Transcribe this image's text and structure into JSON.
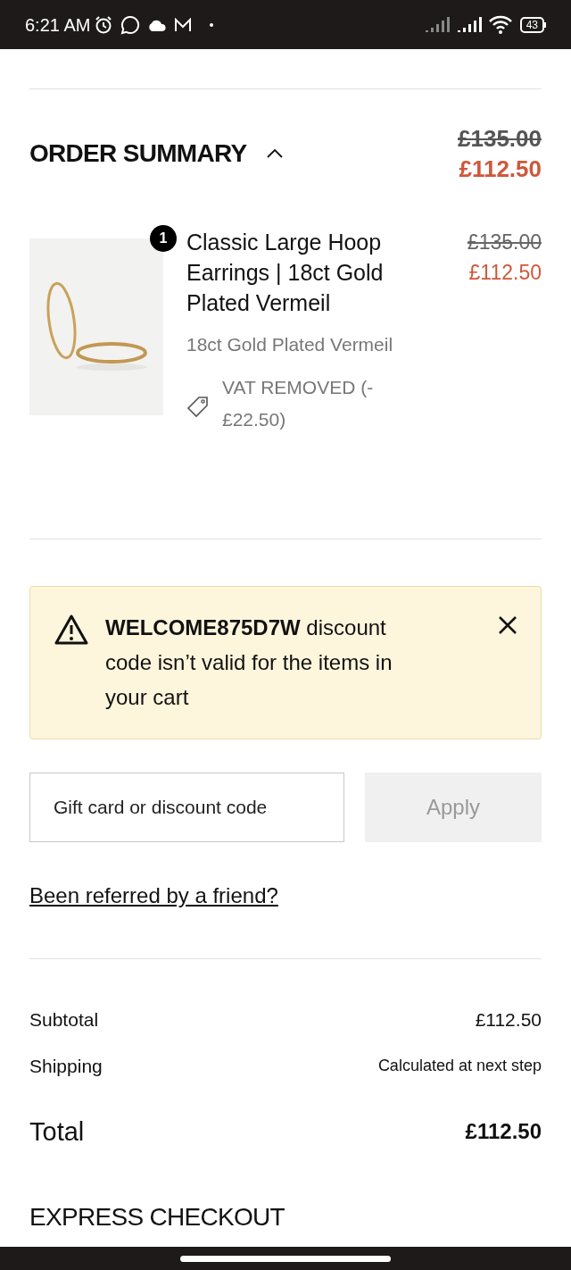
{
  "status_bar": {
    "time": "6:21 AM",
    "battery": "43"
  },
  "order_summary": {
    "title": "ORDER SUMMARY",
    "expanded": true,
    "original_price": "£135.00",
    "price": "£112.50"
  },
  "items": [
    {
      "quantity": "1",
      "name": "Classic Large Hoop Earrings | 18ct Gold Plated Vermeil",
      "variant": "18ct Gold Plated Vermeil",
      "discount": "VAT REMOVED (-£22.50)",
      "original_price": "£135.00",
      "price": "£112.50"
    }
  ],
  "alert": {
    "message": "**WELCOME875D7W** discount code isn’t valid for the items in your cart"
  },
  "discount": {
    "placeholder": "Gift card or discount code",
    "button": "Apply",
    "disabled": true
  },
  "referral_link": "Been referred by a friend?",
  "totals": [
    {
      "kind": "line",
      "label": "Subtotal",
      "value": "£112.50"
    },
    {
      "kind": "note",
      "label": "Shipping",
      "value": "Calculated at next step"
    },
    {
      "kind": "total",
      "label": "Total",
      "value": "£112.50"
    }
  ],
  "next_section": "EXPRESS CHECKOUT"
}
